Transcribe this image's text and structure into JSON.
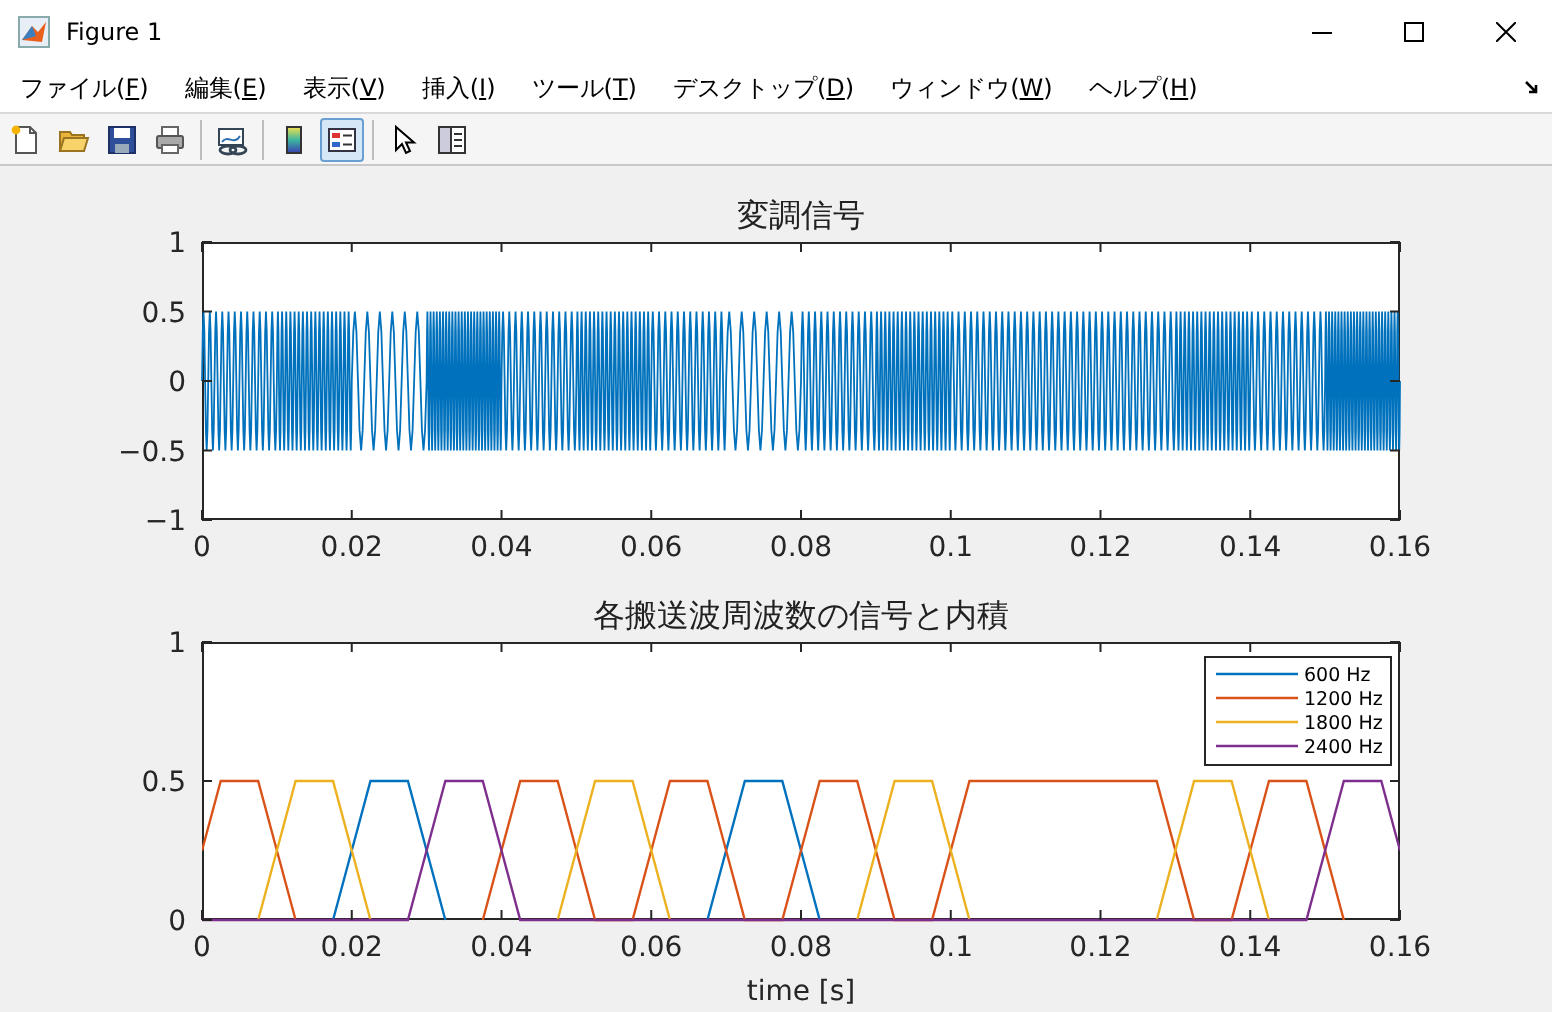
{
  "window": {
    "title": "Figure 1"
  },
  "menu": [
    {
      "label": "ファイル(F)"
    },
    {
      "label": "編集(E)"
    },
    {
      "label": "表示(V)"
    },
    {
      "label": "挿入(I)"
    },
    {
      "label": "ツール(T)"
    },
    {
      "label": "デスクトップ(D)"
    },
    {
      "label": "ウィンドウ(W)"
    },
    {
      "label": "ヘルプ(H)"
    }
  ],
  "toolbar": {
    "groups": [
      {
        "buttons": [
          {
            "kind": "new",
            "selected": false
          },
          {
            "kind": "open",
            "selected": false
          },
          {
            "kind": "save",
            "selected": false
          },
          {
            "kind": "print",
            "selected": false
          }
        ]
      },
      {
        "buttons": [
          {
            "kind": "link",
            "selected": false
          }
        ]
      },
      {
        "buttons": [
          {
            "kind": "colorbar",
            "selected": false
          },
          {
            "kind": "legend",
            "selected": true
          }
        ]
      },
      {
        "buttons": [
          {
            "kind": "pointer",
            "selected": false
          },
          {
            "kind": "inspector",
            "selected": false
          }
        ]
      }
    ]
  },
  "plots": [
    {
      "axes": {
        "title": "変調信号",
        "y_tick_labels": [
          "1",
          "0.5",
          "0",
          "−0.5",
          "−1"
        ],
        "x_tick_labels": [
          "0",
          "0.02",
          "0.04",
          "0.06",
          "0.08",
          "0.1",
          "0.12",
          "0.14",
          "0.16"
        ]
      }
    },
    {
      "chart_data": {
        "type": "line",
        "title": "各搬送波周波数の信号と内積",
        "xlabel": "time [s]",
        "xlim": [
          0,
          0.16
        ],
        "ylim": [
          0,
          1
        ],
        "xticks": [
          {
            "value": 0,
            "label": "0"
          },
          {
            "value": 0.02,
            "label": "0.02"
          },
          {
            "value": 0.04,
            "label": "0.04"
          },
          {
            "value": 0.06,
            "label": "0.06"
          },
          {
            "value": 0.08,
            "label": "0.08"
          },
          {
            "value": 0.1,
            "label": "0.1"
          },
          {
            "value": 0.12,
            "label": "0.12"
          },
          {
            "value": 0.14,
            "label": "0.14"
          },
          {
            "value": 0.16,
            "label": "0.16"
          }
        ],
        "yticks": [
          {
            "value": 0,
            "label": "0"
          },
          {
            "value": 0.5,
            "label": "0.5"
          },
          {
            "value": 1,
            "label": "1"
          }
        ],
        "legend": true,
        "x": [
          0,
          0.0025,
          0.005,
          0.0075,
          0.01,
          0.0125,
          0.015,
          0.0175,
          0.02,
          0.0225,
          0.025,
          0.0275,
          0.03,
          0.0325,
          0.035,
          0.0375,
          0.04,
          0.0425,
          0.045,
          0.0475,
          0.05,
          0.0525,
          0.055,
          0.0575,
          0.06,
          0.0625,
          0.065,
          0.0675,
          0.07,
          0.0725,
          0.075,
          0.0775,
          0.08,
          0.0825,
          0.085,
          0.0875,
          0.09,
          0.0925,
          0.095,
          0.0975,
          0.1,
          0.1025,
          0.105,
          0.1075,
          0.11,
          0.1125,
          0.115,
          0.1175,
          0.12,
          0.1225,
          0.125,
          0.1275,
          0.13,
          0.1325,
          0.135,
          0.1375,
          0.14,
          0.1425,
          0.145,
          0.1475,
          0.15,
          0.1525,
          0.155,
          0.1575,
          0.16
        ],
        "series": [
          {
            "name": "600 Hz",
            "color": "#0072bd",
            "values": [
              null,
              null,
              null,
              null,
              null,
              null,
              null,
              0,
              0.25,
              0.5,
              0.5,
              0.5,
              0.25,
              0,
              null,
              null,
              null,
              null,
              null,
              null,
              null,
              null,
              null,
              null,
              null,
              null,
              null,
              0,
              0.25,
              0.5,
              0.5,
              0.5,
              0.25,
              0,
              null,
              null,
              null,
              null,
              null,
              null,
              null,
              null,
              null,
              null,
              null,
              null,
              null,
              null,
              null,
              null,
              null,
              null,
              null,
              null,
              null,
              null,
              null,
              null,
              null,
              null,
              null,
              null,
              null,
              null,
              null
            ]
          },
          {
            "name": "1200 Hz",
            "color": "#d95319",
            "values": [
              0.25,
              0.5,
              0.5,
              0.5,
              0.25,
              0,
              null,
              null,
              null,
              null,
              null,
              null,
              null,
              null,
              null,
              0,
              0.25,
              0.5,
              0.5,
              0.5,
              0.25,
              0,
              0,
              0,
              0.25,
              0.5,
              0.5,
              0.5,
              0.25,
              0,
              0,
              0,
              0.25,
              0.5,
              0.5,
              0.5,
              0.25,
              0,
              0,
              0,
              0.25,
              0.5,
              0.5,
              0.5,
              0.5,
              0.5,
              0.5,
              0.5,
              0.5,
              0.5,
              0.5,
              0.5,
              0.25,
              0,
              0,
              0,
              0.25,
              0.5,
              0.5,
              0.5,
              0.25,
              0,
              null,
              null,
              null
            ]
          },
          {
            "name": "1800 Hz",
            "color": "#edb120",
            "values": [
              null,
              null,
              null,
              0,
              0.25,
              0.5,
              0.5,
              0.5,
              0.25,
              0,
              null,
              null,
              null,
              null,
              null,
              null,
              null,
              null,
              null,
              0,
              0.25,
              0.5,
              0.5,
              0.5,
              0.25,
              0,
              null,
              null,
              null,
              null,
              null,
              null,
              null,
              null,
              null,
              0,
              0.25,
              0.5,
              0.5,
              0.5,
              0.25,
              0,
              null,
              null,
              null,
              null,
              null,
              null,
              null,
              null,
              null,
              0,
              0.25,
              0.5,
              0.5,
              0.5,
              0.25,
              0,
              null,
              null,
              null,
              null,
              null,
              null,
              null
            ]
          },
          {
            "name": "2400 Hz",
            "color": "#7e2f8e",
            "values": [
              0,
              0,
              0,
              0,
              0,
              0,
              0,
              0,
              0,
              0,
              0,
              0,
              0.25,
              0.5,
              0.5,
              0.5,
              0.25,
              0,
              0,
              0,
              0,
              0,
              0,
              0,
              0,
              0,
              0,
              0,
              0,
              0,
              0,
              0,
              0,
              0,
              0,
              0,
              0,
              0,
              0,
              0,
              0,
              0,
              0,
              0,
              0,
              0,
              0,
              0,
              0,
              0,
              0,
              0,
              0,
              0,
              0,
              0,
              0,
              0,
              0,
              0,
              0.25,
              0.5,
              0.5,
              0.5,
              0.25
            ]
          }
        ]
      }
    }
  ]
}
